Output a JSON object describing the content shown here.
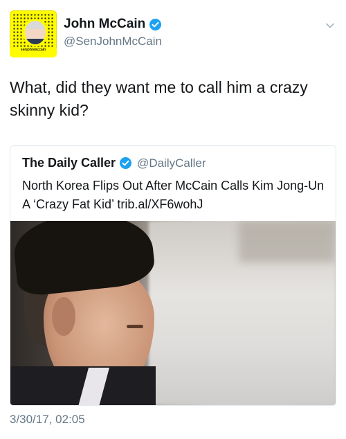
{
  "tweet": {
    "author_name": "John McCain",
    "author_handle": "@SenJohnMcCain",
    "avatar_caption": "senjohnmccain",
    "text": "What, did they want me to call him a crazy skinny kid?",
    "timestamp": "3/30/17, 02:05"
  },
  "quoted": {
    "author_name": "The Daily Caller",
    "author_handle": "@DailyCaller",
    "text": "North Korea Flips Out After McCain Calls Kim Jong-Un A ‘Crazy Fat Kid’ trib.al/XF6wohJ"
  },
  "colors": {
    "verified": "#1da1f2",
    "secondary_text": "#657786",
    "snapcode_yellow": "#fffc00"
  },
  "icons": {
    "verified": "verified-badge-icon",
    "menu": "chevron-down-icon"
  }
}
